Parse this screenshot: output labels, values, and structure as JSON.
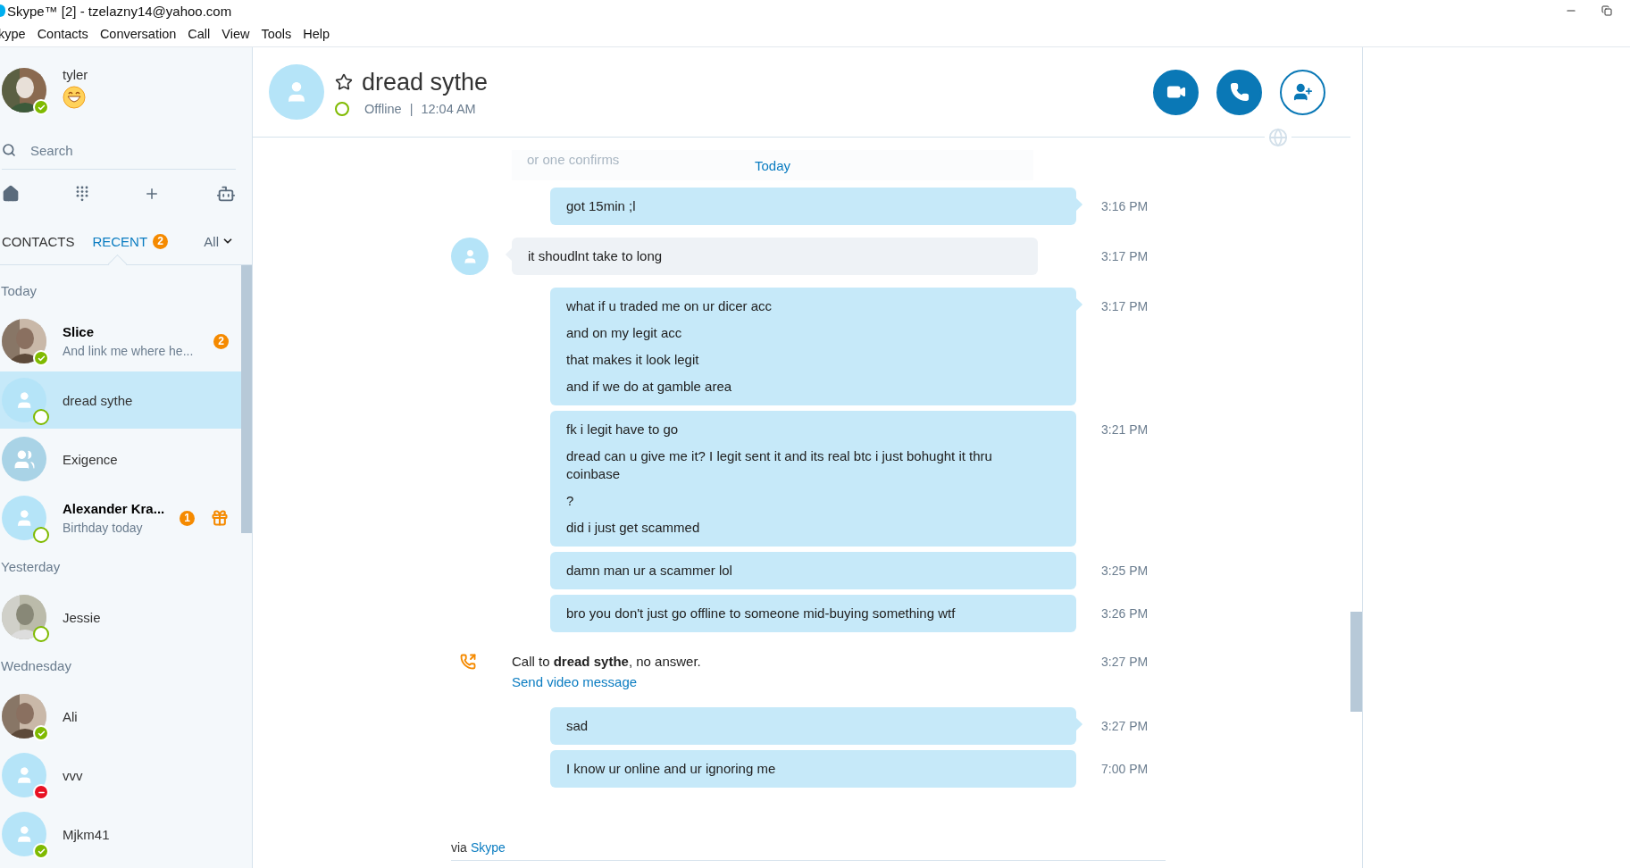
{
  "window": {
    "title": "Skype™ [2] - tzelazny14@yahoo.com"
  },
  "menu": [
    "kype",
    "Contacts",
    "Conversation",
    "Call",
    "View",
    "Tools",
    "Help"
  ],
  "profile": {
    "name": "tyler",
    "status_badge": {
      "kind": "online"
    }
  },
  "search": {
    "placeholder": "Search"
  },
  "sidebar_tabs": [
    {
      "label": "CONTACTS",
      "selected": false
    },
    {
      "label": "RECENT",
      "selected": true,
      "badge": "2"
    }
  ],
  "filter": {
    "label": "All"
  },
  "recent": [
    {
      "label": "Today",
      "contacts": [
        {
          "name": "Slice",
          "subtitle": "And link me where he...",
          "status_badge": {
            "kind": "online"
          },
          "unread": true,
          "badge": "2",
          "gift": false,
          "selected": false
        },
        {
          "name": "dread sythe",
          "avatar": {
            "kind": "default"
          },
          "status_badge": {
            "kind": "offline"
          },
          "unread": false,
          "gift": false,
          "selected": true
        },
        {
          "name": "Exigence",
          "avatar": {
            "kind": "group"
          },
          "unread": false,
          "gift": false,
          "selected": false
        },
        {
          "name": "Alexander Kra...",
          "subtitle": "Birthday today",
          "avatar": {
            "kind": "default"
          },
          "status_badge": {
            "kind": "offline"
          },
          "unread": true,
          "badge": "1",
          "gift": true,
          "selected": false
        }
      ]
    },
    {
      "label": "Yesterday",
      "contacts": [
        {
          "name": "Jessie",
          "status_badge": {
            "kind": "offline"
          },
          "unread": false,
          "gift": false,
          "selected": false
        }
      ]
    },
    {
      "label": "Wednesday",
      "contacts": [
        {
          "name": "Ali",
          "status_badge": {
            "kind": "online"
          },
          "unread": false,
          "gift": false,
          "selected": false
        },
        {
          "name": "vvv",
          "avatar": {
            "kind": "default"
          },
          "status_badge": {
            "kind": "dnd"
          },
          "unread": false,
          "gift": false,
          "selected": false
        },
        {
          "name": "Mjkm41",
          "avatar": {
            "kind": "default"
          },
          "status_badge": {
            "kind": "online"
          },
          "unread": false,
          "gift": false,
          "selected": false
        }
      ]
    }
  ],
  "conversation": {
    "name": "dread sythe",
    "status_badge": {
      "kind": "offline"
    },
    "status_text": "Offline",
    "separator": "|",
    "local_time": "12:04 AM"
  },
  "chat": {
    "faded_text": "or one confirms",
    "date_label": "Today",
    "messages": [
      {
        "kind": "outgoing",
        "lines": [
          "got 15min ;l"
        ],
        "time": "3:16 PM",
        "tail": true
      },
      {
        "kind": "incoming",
        "lines": [
          "it shoudlnt take to long"
        ],
        "time": "3:17 PM",
        "tail": true
      },
      {
        "kind": "outgoing",
        "lines": [
          "what if u traded me on ur dicer acc",
          "and on my legit acc",
          "that makes it look legit",
          "and if we do at gamble area"
        ],
        "time": "3:17 PM",
        "tail": true
      },
      {
        "kind": "outgoing",
        "lines": [
          "fk i legit have to go",
          "dread can u give me it? I legit sent it and its real btc i just bohught it thru coinbase",
          "?",
          "did i just get scammed"
        ],
        "time": "3:21 PM",
        "tail": false
      },
      {
        "kind": "outgoing",
        "lines": [
          "damn man ur a scammer lol"
        ],
        "time": "3:25 PM",
        "tail": false
      },
      {
        "kind": "outgoing",
        "lines": [
          "bro you don't just go offline to someone mid-buying something wtf"
        ],
        "time": "3:26 PM",
        "tail": false
      },
      {
        "kind": "call",
        "text": "Call to **dread sythe**, no answer.",
        "link": "Send video message",
        "time": "3:27 PM"
      },
      {
        "kind": "outgoing",
        "lines": [
          "sad"
        ],
        "time": "3:27 PM",
        "tail": true
      },
      {
        "kind": "outgoing",
        "lines": [
          "I know ur online and ur ignoring me"
        ],
        "time": "7:00 PM",
        "tail": false
      }
    ],
    "footer": {
      "prefix": "via",
      "link": "Skype"
    }
  }
}
